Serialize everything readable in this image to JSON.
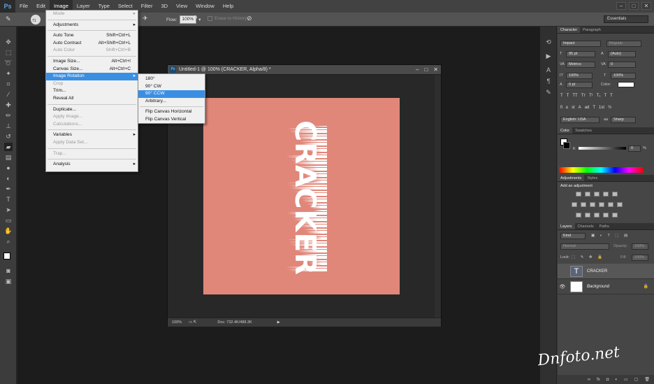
{
  "app": {
    "logo": "Ps"
  },
  "menubar": {
    "items": [
      "File",
      "Edit",
      "Image",
      "Layer",
      "Type",
      "Select",
      "Filter",
      "3D",
      "View",
      "Window",
      "Help"
    ],
    "active": "Image"
  },
  "window_controls": [
    "–",
    "□",
    "✕"
  ],
  "options": {
    "brush_size": "71",
    "flow_label": "Flow:",
    "flow_value": "100%",
    "erase_to_history": "Erase to History",
    "workspace": "Essentials"
  },
  "image_menu": {
    "items": [
      {
        "label": "Mode",
        "shortcut": "",
        "submenu": true,
        "disabled": true
      },
      {
        "sep": true
      },
      {
        "label": "Adjustments",
        "shortcut": "",
        "submenu": true
      },
      {
        "sep": true
      },
      {
        "label": "Auto Tone",
        "shortcut": "Shift+Ctrl+L"
      },
      {
        "label": "Auto Contrast",
        "shortcut": "Alt+Shift+Ctrl+L"
      },
      {
        "label": "Auto Color",
        "shortcut": "Shift+Ctrl+B",
        "disabled": true
      },
      {
        "sep": true
      },
      {
        "label": "Image Size...",
        "shortcut": "Alt+Ctrl+I"
      },
      {
        "label": "Canvas Size...",
        "shortcut": "Alt+Ctrl+C"
      },
      {
        "label": "Image Rotation",
        "shortcut": "",
        "submenu": true,
        "highlighted": true
      },
      {
        "label": "Crop",
        "shortcut": "",
        "disabled": true
      },
      {
        "label": "Trim...",
        "shortcut": ""
      },
      {
        "label": "Reveal All",
        "shortcut": ""
      },
      {
        "sep": true
      },
      {
        "label": "Duplicate...",
        "shortcut": ""
      },
      {
        "label": "Apply Image...",
        "shortcut": "",
        "disabled": true
      },
      {
        "label": "Calculations...",
        "shortcut": "",
        "disabled": true
      },
      {
        "sep": true
      },
      {
        "label": "Variables",
        "shortcut": "",
        "submenu": true
      },
      {
        "label": "Apply Data Set...",
        "shortcut": "",
        "disabled": true
      },
      {
        "sep": true
      },
      {
        "label": "Trap...",
        "shortcut": "",
        "disabled": true
      },
      {
        "sep": true
      },
      {
        "label": "Analysis",
        "shortcut": "",
        "submenu": true
      }
    ]
  },
  "rotation_menu": {
    "items": [
      {
        "label": "180°"
      },
      {
        "label": "90° CW"
      },
      {
        "label": "90° CCW",
        "highlighted": true
      },
      {
        "label": "Arbitrary..."
      },
      {
        "sep": true
      },
      {
        "label": "Flip Canvas Horizontal"
      },
      {
        "label": "Flip Canvas Vertical"
      }
    ]
  },
  "document": {
    "title": "Untitled-1 @ 100% (CRACKER, Alpha/8) *",
    "controls": [
      "–",
      "□",
      "✕"
    ],
    "artwork_text": "CRACKER",
    "canvas_color": "#e0877a",
    "zoom": "100%",
    "doc_info": "Doc: 732.4K/488.3K"
  },
  "character_panel": {
    "tabs": [
      "Character",
      "Paragraph"
    ],
    "font": "Impact",
    "style": "Regular",
    "size": "95 pt",
    "leading": "(Auto)",
    "kerning": "Metrics",
    "tracking": "0",
    "vscale": "100%",
    "hscale": "100%",
    "baseline": "0 pt",
    "color_label": "Color:",
    "language": "English: USA",
    "antialias": "Sharp"
  },
  "color_panel": {
    "tabs": [
      "Color",
      "Swatches"
    ],
    "k_label": "K",
    "k_value": "0",
    "k_unit": "%"
  },
  "adjustments_panel": {
    "tabs": [
      "Adjustments",
      "Styles"
    ],
    "hint": "Add an adjustment"
  },
  "layers_panel": {
    "tabs": [
      "Layers",
      "Channels",
      "Paths"
    ],
    "filter": "Kind",
    "blend_mode": "Normal",
    "opacity_label": "Opacity:",
    "opacity": "100%",
    "lock_label": "Lock:",
    "fill_label": "Fill:",
    "fill": "100%",
    "layers": [
      {
        "name": "CRACKER",
        "type": "text",
        "visible": false
      },
      {
        "name": "Background",
        "type": "bg",
        "visible": true
      }
    ]
  },
  "watermark": "Dnfoto.net"
}
